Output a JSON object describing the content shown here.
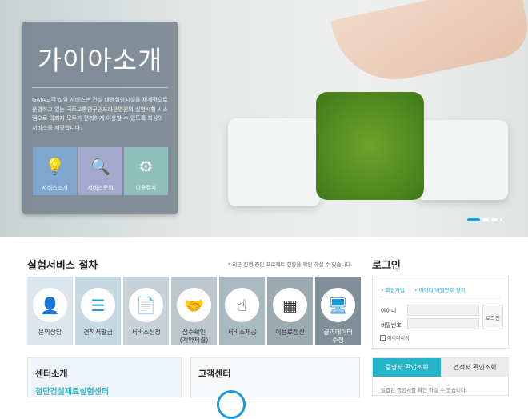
{
  "hero": {
    "title": "가이아소개",
    "description": "GAIA고객 실험 서비스는 건설 대형실험시설을 체계적으로 운영하고 있는 국토교통연구인프라운영원의 실험시험 시스템으로 의뢰자 모두가 편리하게 이용할 수 있도록 최상의 서비스를 제공합니다.",
    "buttons": [
      {
        "label": "서비스소개",
        "icon": "lightbulb-icon",
        "color": "#7fa6cf"
      },
      {
        "label": "서비스문의",
        "icon": "magnifier-question-icon",
        "color": "#a4a8cd"
      },
      {
        "label": "이용절차",
        "icon": "gear-icon",
        "color": "#8fbfba"
      }
    ],
    "slider": {
      "count": 4,
      "active": 1,
      "accent": "#1e9bd7"
    }
  },
  "procedure": {
    "title": "실험서비스 절차",
    "note": "* 최근 진행 중인 프로젝트 현황을 확인 하실 수 있습니다.",
    "steps": [
      {
        "label": "문의상담",
        "icon": "headset-person-icon"
      },
      {
        "label": "견적서발급",
        "icon": "document-pen-icon"
      },
      {
        "label": "서비스신청",
        "icon": "document-send-icon"
      },
      {
        "label": "접수확인\n(계약체결)",
        "icon": "handshake-icon"
      },
      {
        "label": "서비스제공",
        "icon": "touch-icon"
      },
      {
        "label": "이용료정산",
        "icon": "calculator-icon"
      },
      {
        "label": "결과데이터\n수정",
        "icon": "monitor-user-icon"
      }
    ]
  },
  "login": {
    "title": "로그인",
    "join": "• 회원가입",
    "find": "• 아이디/비밀번호 찾기",
    "id_label": "아이디",
    "pw_label": "비밀번호",
    "button": "로그인",
    "save_id": "아이디저장"
  },
  "certificate": {
    "tab_active": "증명서 확인조회",
    "tab_other": "견적서 확인조회",
    "text": "발급된 증명서를 확인 하실 수 있습니다."
  },
  "center": {
    "title": "센터소개",
    "subtitle": "첨단건설재료실험센터"
  },
  "support": {
    "title": "고객센터"
  }
}
